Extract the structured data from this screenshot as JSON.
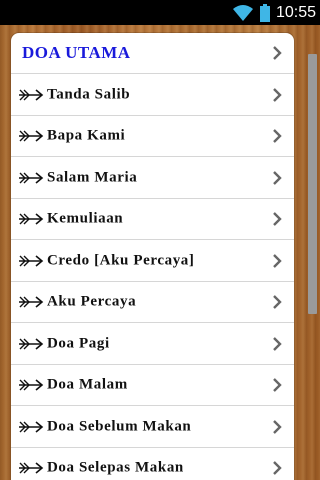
{
  "status_bar": {
    "time": "10:55",
    "icons": [
      "wifi-icon",
      "battery-icon"
    ]
  },
  "list": {
    "header": "DOA UTAMA",
    "items": [
      "Tanda Salib",
      "Bapa Kami",
      "Salam Maria",
      "Kemuliaan",
      "Credo [Aku Percaya]",
      "Aku Percaya",
      "Doa Pagi",
      "Doa Malam",
      "Doa Sebelum Makan",
      "Doa Selepas Makan"
    ]
  },
  "colors": {
    "header_text": "#1a1adb",
    "item_text": "#111111",
    "wood": "#a86a30"
  }
}
